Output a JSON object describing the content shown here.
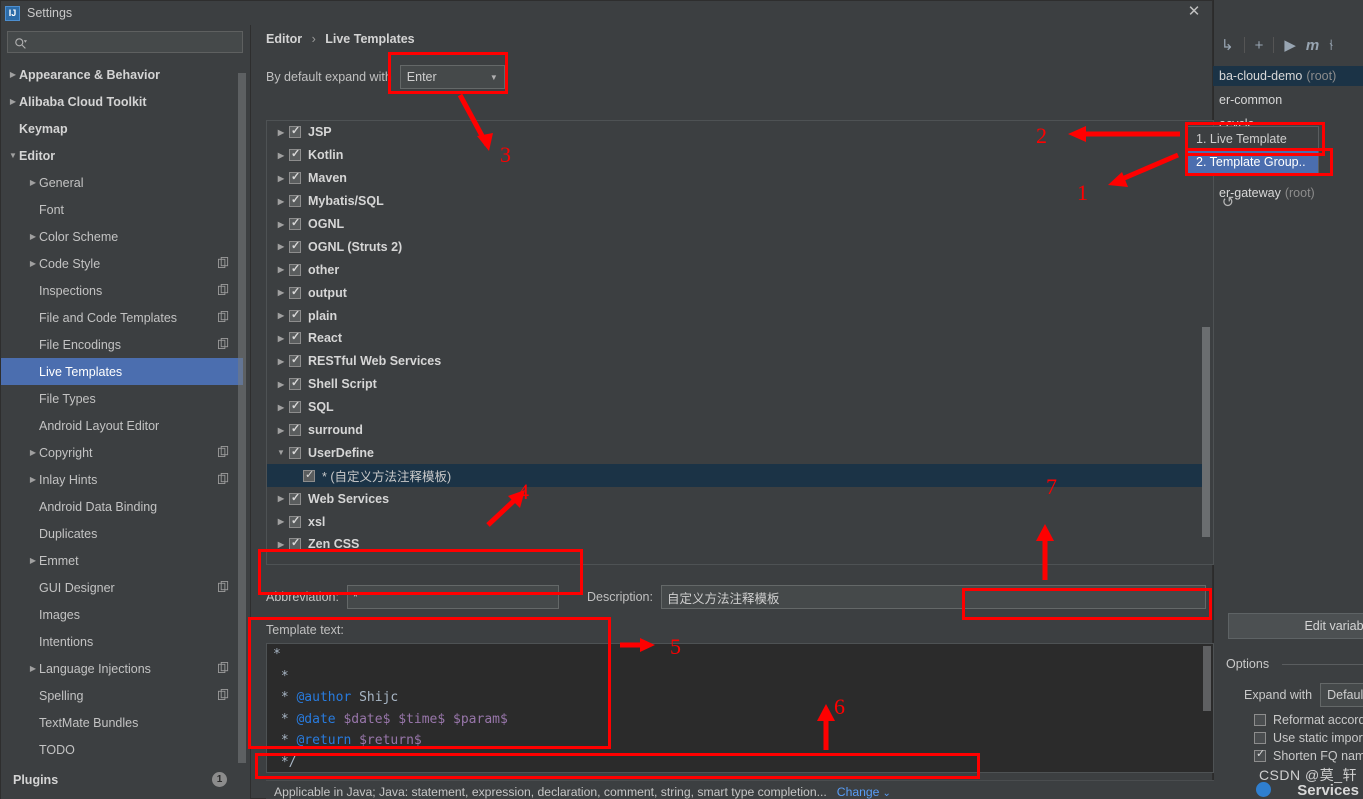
{
  "dialog": {
    "title": "Settings",
    "close_label": "✕",
    "app_icon": "intellij-idea-icon"
  },
  "search": {
    "placeholder": "",
    "value": "",
    "icon": "search-icon"
  },
  "sidebar": {
    "items": [
      {
        "label": "Appearance & Behavior",
        "arrow": "▶",
        "level": 0,
        "bold": true,
        "copy": false,
        "selected": false
      },
      {
        "label": "Alibaba Cloud Toolkit",
        "arrow": "▶",
        "level": 0,
        "bold": true,
        "copy": false,
        "selected": false
      },
      {
        "label": "Keymap",
        "arrow": "",
        "level": 0,
        "bold": true,
        "copy": false,
        "selected": false
      },
      {
        "label": "Editor",
        "arrow": "▼",
        "level": 0,
        "bold": true,
        "copy": false,
        "selected": false
      },
      {
        "label": "General",
        "arrow": "▶",
        "level": 1,
        "bold": false,
        "copy": false,
        "selected": false
      },
      {
        "label": "Font",
        "arrow": "",
        "level": 1,
        "bold": false,
        "copy": false,
        "selected": false
      },
      {
        "label": "Color Scheme",
        "arrow": "▶",
        "level": 1,
        "bold": false,
        "copy": false,
        "selected": false
      },
      {
        "label": "Code Style",
        "arrow": "▶",
        "level": 1,
        "bold": false,
        "copy": true,
        "selected": false
      },
      {
        "label": "Inspections",
        "arrow": "",
        "level": 1,
        "bold": false,
        "copy": true,
        "selected": false
      },
      {
        "label": "File and Code Templates",
        "arrow": "",
        "level": 1,
        "bold": false,
        "copy": true,
        "selected": false
      },
      {
        "label": "File Encodings",
        "arrow": "",
        "level": 1,
        "bold": false,
        "copy": true,
        "selected": false
      },
      {
        "label": "Live Templates",
        "arrow": "",
        "level": 1,
        "bold": false,
        "copy": false,
        "selected": true
      },
      {
        "label": "File Types",
        "arrow": "",
        "level": 1,
        "bold": false,
        "copy": false,
        "selected": false
      },
      {
        "label": "Android Layout Editor",
        "arrow": "",
        "level": 1,
        "bold": false,
        "copy": false,
        "selected": false
      },
      {
        "label": "Copyright",
        "arrow": "▶",
        "level": 1,
        "bold": false,
        "copy": true,
        "selected": false
      },
      {
        "label": "Inlay Hints",
        "arrow": "▶",
        "level": 1,
        "bold": false,
        "copy": true,
        "selected": false
      },
      {
        "label": "Android Data Binding",
        "arrow": "",
        "level": 1,
        "bold": false,
        "copy": false,
        "selected": false
      },
      {
        "label": "Duplicates",
        "arrow": "",
        "level": 1,
        "bold": false,
        "copy": false,
        "selected": false
      },
      {
        "label": "Emmet",
        "arrow": "▶",
        "level": 1,
        "bold": false,
        "copy": false,
        "selected": false
      },
      {
        "label": "GUI Designer",
        "arrow": "",
        "level": 1,
        "bold": false,
        "copy": true,
        "selected": false
      },
      {
        "label": "Images",
        "arrow": "",
        "level": 1,
        "bold": false,
        "copy": false,
        "selected": false
      },
      {
        "label": "Intentions",
        "arrow": "",
        "level": 1,
        "bold": false,
        "copy": false,
        "selected": false
      },
      {
        "label": "Language Injections",
        "arrow": "▶",
        "level": 1,
        "bold": false,
        "copy": true,
        "selected": false
      },
      {
        "label": "Spelling",
        "arrow": "",
        "level": 1,
        "bold": false,
        "copy": true,
        "selected": false
      },
      {
        "label": "TextMate Bundles",
        "arrow": "",
        "level": 1,
        "bold": false,
        "copy": false,
        "selected": false
      },
      {
        "label": "TODO",
        "arrow": "",
        "level": 1,
        "bold": false,
        "copy": false,
        "selected": false
      }
    ],
    "plugins": {
      "label": "Plugins",
      "badge": "1"
    }
  },
  "content": {
    "breadcrumb": {
      "root": "Editor",
      "separator": "›",
      "leaf": "Live Templates"
    },
    "expand_with": {
      "label": "By default expand with",
      "value": "Enter",
      "caret": "▼"
    },
    "templates": [
      {
        "label": "JSP",
        "checked": true,
        "expanded": false,
        "child": false,
        "selected": false
      },
      {
        "label": "Kotlin",
        "checked": true,
        "expanded": false,
        "child": false,
        "selected": false
      },
      {
        "label": "Maven",
        "checked": true,
        "expanded": false,
        "child": false,
        "selected": false
      },
      {
        "label": "Mybatis/SQL",
        "checked": true,
        "expanded": false,
        "child": false,
        "selected": false
      },
      {
        "label": "OGNL",
        "checked": true,
        "expanded": false,
        "child": false,
        "selected": false
      },
      {
        "label": "OGNL (Struts 2)",
        "checked": true,
        "expanded": false,
        "child": false,
        "selected": false
      },
      {
        "label": "other",
        "checked": true,
        "expanded": false,
        "child": false,
        "selected": false
      },
      {
        "label": "output",
        "checked": true,
        "expanded": false,
        "child": false,
        "selected": false
      },
      {
        "label": "plain",
        "checked": true,
        "expanded": false,
        "child": false,
        "selected": false
      },
      {
        "label": "React",
        "checked": true,
        "expanded": false,
        "child": false,
        "selected": false
      },
      {
        "label": "RESTful Web Services",
        "checked": true,
        "expanded": false,
        "child": false,
        "selected": false
      },
      {
        "label": "Shell Script",
        "checked": true,
        "expanded": false,
        "child": false,
        "selected": false
      },
      {
        "label": "SQL",
        "checked": true,
        "expanded": false,
        "child": false,
        "selected": false
      },
      {
        "label": "surround",
        "checked": true,
        "expanded": false,
        "child": false,
        "selected": false
      },
      {
        "label": "UserDefine",
        "checked": true,
        "expanded": true,
        "child": false,
        "selected": false
      },
      {
        "label": "* (自定义方法注释模板)",
        "checked": true,
        "expanded": null,
        "child": true,
        "selected": true
      },
      {
        "label": "Web Services",
        "checked": true,
        "expanded": false,
        "child": false,
        "selected": false
      },
      {
        "label": "xsl",
        "checked": true,
        "expanded": false,
        "child": false,
        "selected": false
      },
      {
        "label": "Zen CSS",
        "checked": true,
        "expanded": false,
        "child": false,
        "selected": false
      }
    ],
    "list_toolbar": {
      "add": "+",
      "revert": "↺"
    },
    "abbreviation": {
      "label": "Abbreviation:",
      "value": "*"
    },
    "description": {
      "label": "Description:",
      "value": "自定义方法注释模板"
    },
    "template_text": {
      "label": "Template text:",
      "lines": [
        "*",
        " *",
        " * @author Shijc",
        " * @date $date$ $time$ $param$",
        " * @return $return$",
        " */"
      ]
    },
    "applicable": {
      "text": "Applicable in Java; Java: statement, expression, declaration, comment, string, smart type completion...",
      "change_label": "Change",
      "change_caret": "⌄"
    },
    "options": {
      "edit_variables_label": "Edit variables",
      "group_title": "Options",
      "expand_with": {
        "label": "Expand with",
        "value": "Default (Enter)",
        "caret": "▼"
      },
      "checkboxes": [
        {
          "label": "Reformat according to style",
          "checked": false
        },
        {
          "label": "Use static import if possible",
          "checked": false
        },
        {
          "label": "Shorten FQ names",
          "checked": true
        }
      ]
    }
  },
  "popup_menu": {
    "items": [
      {
        "label": "1. Live Template",
        "selected": false
      },
      {
        "label": "2. Template Group..",
        "selected": true
      }
    ]
  },
  "background_ide": {
    "toolbar_icons": [
      "run-icon",
      "maven-m-icon",
      "branch-icon"
    ],
    "add_icon": "+",
    "projects": [
      {
        "name": "ba-cloud-demo",
        "suffix": "(root)",
        "selected": true
      },
      {
        "name": "er-common",
        "suffix": "",
        "selected": false
      },
      {
        "name": "ecycle",
        "suffix": "",
        "selected": false
      },
      {
        "name": "er-gateway",
        "suffix": "(root)",
        "selected": false
      }
    ],
    "services_label": "Services"
  },
  "annotations": {
    "numbers": [
      "1",
      "2",
      "3",
      "4",
      "5",
      "6",
      "7"
    ]
  },
  "watermark": {
    "text": "CSDN @莫_轩"
  },
  "colors": {
    "accent_selection": "#4b6eaf",
    "tree_selection": "#1b3346",
    "annotation_red": "#ff0000",
    "link_blue": "#589df6",
    "code_keyword": "#287bde",
    "code_variable": "#9876aa"
  }
}
